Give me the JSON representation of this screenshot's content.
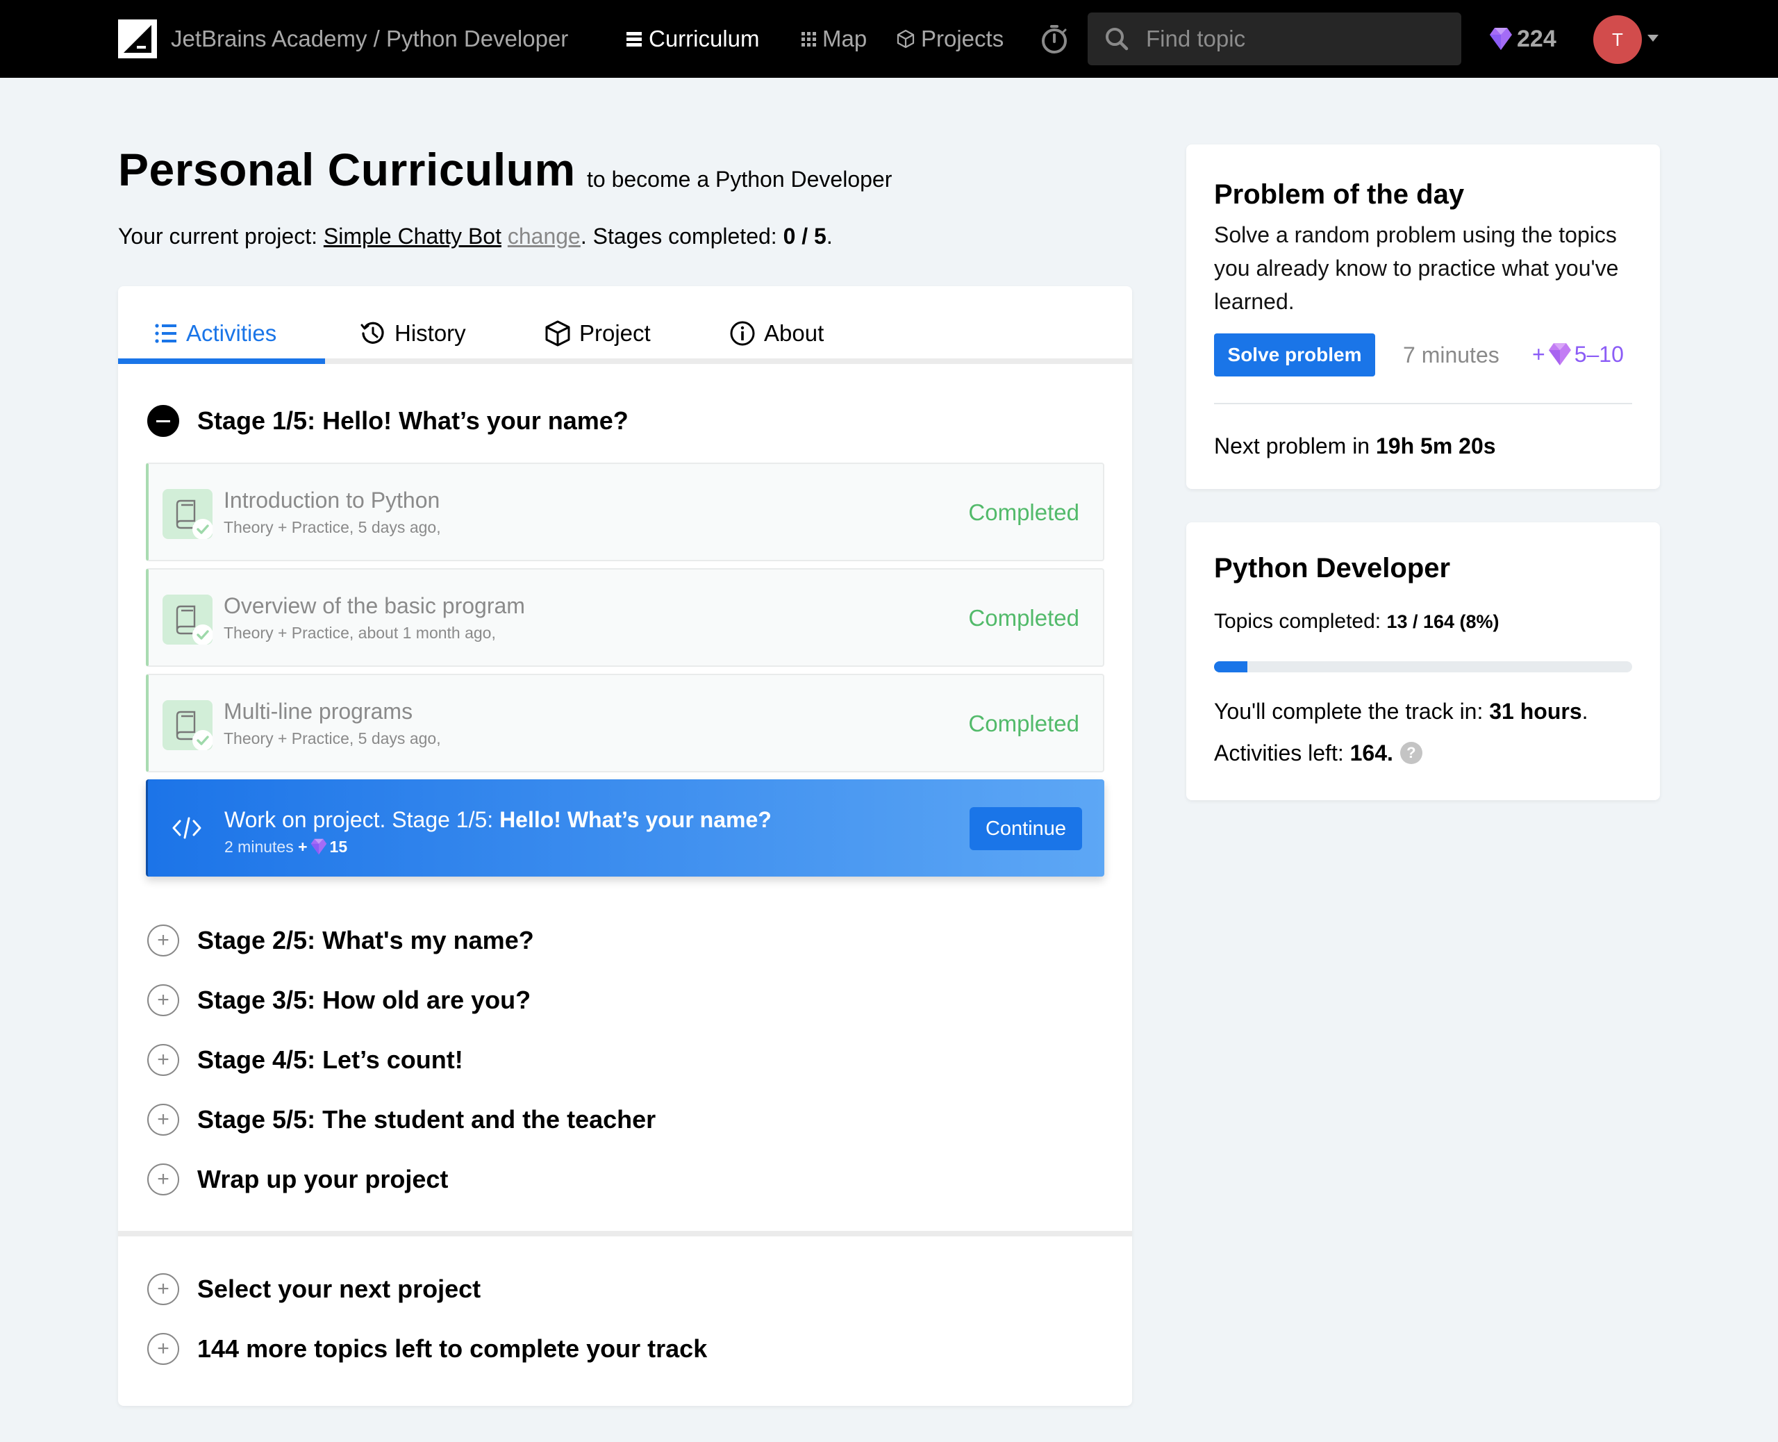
{
  "nav": {
    "brand": "JetBrains Academy / Python Developer",
    "links": [
      {
        "label": "Curriculum",
        "icon": "list-icon",
        "active": true
      },
      {
        "label": "Map",
        "icon": "grid-icon",
        "active": false
      },
      {
        "label": "Projects",
        "icon": "cube-icon",
        "active": false
      }
    ],
    "search_placeholder": "Find topic",
    "gems": "224",
    "avatar_initial": "T"
  },
  "header": {
    "title": "Personal Curriculum",
    "subtitle": "to become a Python Developer",
    "project_prefix": "Your current project: ",
    "project_name": "Simple Chatty Bot",
    "change_label": "change",
    "stages_prefix": ". Stages completed: ",
    "stages_value": "0 / 5",
    "stages_suffix": "."
  },
  "tabs": [
    {
      "label": "Activities",
      "icon": "list-icon",
      "active": true
    },
    {
      "label": "History",
      "icon": "history-icon",
      "active": false
    },
    {
      "label": "Project",
      "icon": "cube-icon",
      "active": false
    },
    {
      "label": "About",
      "icon": "info-icon",
      "active": false
    }
  ],
  "current_stage": {
    "title": "Stage 1/5: Hello! What’s your name?",
    "expanded": true,
    "topics": [
      {
        "title": "Introduction to Python",
        "subtitle": "Theory + Practice, 5 days ago,",
        "status": "Completed"
      },
      {
        "title": "Overview of the basic program",
        "subtitle": "Theory + Practice, about 1 month ago,",
        "status": "Completed"
      },
      {
        "title": "Multi-line programs",
        "subtitle": "Theory + Practice, 5 days ago,",
        "status": "Completed"
      }
    ],
    "project_task": {
      "prefix": "Work on project. Stage 1/5: ",
      "name": "Hello! What’s your name?",
      "duration": "2 minutes",
      "plus": "+",
      "reward": "15",
      "button": "Continue"
    }
  },
  "other_stages": [
    "Stage 2/5: What's my name?",
    "Stage 3/5: How old are you?",
    "Stage 4/5: Let’s count!",
    "Stage 5/5: The student and the teacher",
    "Wrap up your project"
  ],
  "bottom_items": [
    "Select your next project",
    "144 more topics left to complete your track"
  ],
  "problem_of_day": {
    "title": "Problem of the day",
    "description": "Solve a random problem using the topics you already know to practice what you've learned.",
    "button": "Solve problem",
    "duration": "7 minutes",
    "reward_plus": "+",
    "reward": "5–10",
    "next_label": "Next problem in ",
    "next_value": "19h 5m 20s"
  },
  "track": {
    "title": "Python Developer",
    "topics_label": "Topics completed: ",
    "topics_value": "13 / 164 (8%)",
    "progress_percent": 8,
    "eta_label": "You'll complete the track in: ",
    "eta_value": "31 hours",
    "eta_suffix": ".",
    "activities_label": "Activities left: ",
    "activities_value": "164.",
    "help": "?"
  },
  "colors": {
    "accent": "#1a75e8",
    "completed": "#52ba6a",
    "gem": "#8b5cf6",
    "avatar": "#d24c4c"
  }
}
